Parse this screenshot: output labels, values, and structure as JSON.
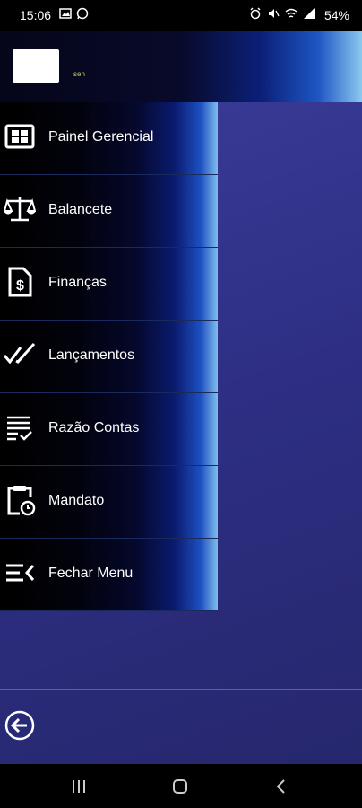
{
  "status_bar": {
    "time": "15:06",
    "battery": "54%",
    "left_icons": [
      "gallery-icon",
      "whatsapp-icon"
    ],
    "right_icons": [
      "alarm-icon",
      "mute-icon",
      "wifi-icon",
      "signal-icon"
    ]
  },
  "header": {
    "tag": "sen"
  },
  "menu": {
    "items": [
      {
        "label": "Painel Gerencial",
        "icon": "dashboard-icon"
      },
      {
        "label": "Balancete",
        "icon": "scale-icon"
      },
      {
        "label": "Finanças",
        "icon": "finance-document-icon"
      },
      {
        "label": "Lançamentos",
        "icon": "double-check-icon"
      },
      {
        "label": "Razão Contas",
        "icon": "ledger-list-icon"
      },
      {
        "label": "Mandato",
        "icon": "clipboard-clock-icon"
      },
      {
        "label": "Fechar Menu",
        "icon": "close-menu-icon"
      }
    ]
  },
  "colors": {
    "accent": "#1d4fc0",
    "background": "#2f3080",
    "menu_dark": "#000000"
  }
}
